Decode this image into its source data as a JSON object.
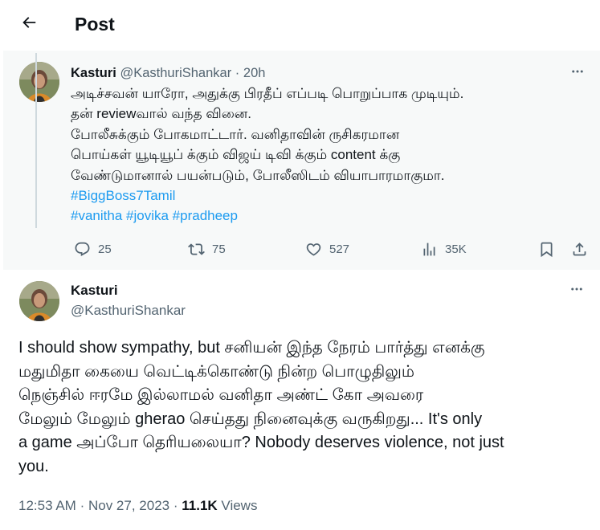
{
  "header": {
    "title": "Post"
  },
  "parent_tweet": {
    "name": "Kasturi",
    "handle": "@KasthuriShankar",
    "separator": "·",
    "time": "20h",
    "text_lines": [
      "அடிச்சவன் யாரோ, அதுக்கு பிரதீப் எப்படி பொறுப்பாக முடியும்.",
      "தன் reviewவால் வந்த வினை.",
      "போலீசுக்கும் போகமாட்டார். வனிதாவின் ருசிகரமான",
      "பொய்கள் யூடியூப் க்கும் விஜய் டிவி க்கும்  content க்கு",
      "வேண்டுமானால் பயன்படும், போலீஸிடம் வியாபாரமாகுமா."
    ],
    "hashtags": {
      "line1": [
        "#BiggBoss7Tamil"
      ],
      "line2": [
        "#vanitha",
        "#jovika",
        "#pradheep"
      ]
    },
    "stats": {
      "replies": "25",
      "reposts": "75",
      "likes": "527",
      "views": "35K"
    }
  },
  "main_tweet": {
    "name": "Kasturi",
    "handle": "@KasthuriShankar",
    "text_lines": [
      "I should show sympathy, but சனியன் இந்த நேரம் பார்த்து எனக்கு",
      "மதுமிதா கையை வெட்டிக்கொண்டு நின்ற பொழுதிலும்",
      "நெஞ்சில் ஈரமே இல்லாமல் வனிதா அண்ட் கோ அவரை",
      "மேலும் மேலும்  gherao செய்தது நினைவுக்கு வருகிறது... It's  only",
      "a game அப்போ தெரியலையா? Nobody deserves violence, not just",
      "you."
    ],
    "time": "12:53 AM",
    "separator": "·",
    "date": "Nov 27, 2023",
    "views_count": "11.1K",
    "views_label": "Views"
  },
  "icons": {
    "back": "arrow-left-icon",
    "more": "more-horizontal-icon",
    "reply": "reply-icon",
    "repost": "repost-icon",
    "like": "heart-icon",
    "views": "analytics-icon",
    "bookmark": "bookmark-icon",
    "share": "share-icon"
  },
  "colors": {
    "text": "#0f1419",
    "secondary": "#536471",
    "link": "#1d9bf0",
    "parent_bg": "#f7f9f9",
    "thread_line": "#cfd9de"
  }
}
